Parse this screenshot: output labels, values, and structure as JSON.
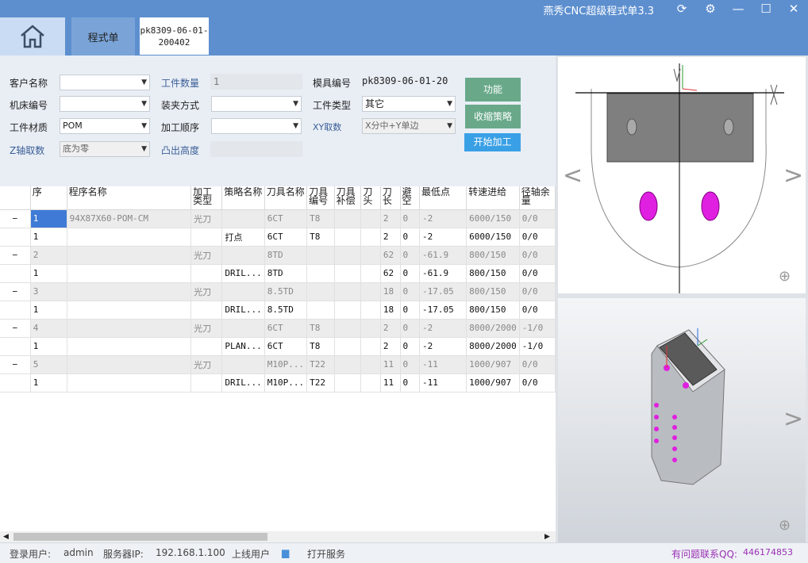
{
  "window": {
    "title": "燕秀CNC超级程式单3.3",
    "buttons": [
      "refresh-icon",
      "settings-icon",
      "minimize-icon",
      "maximize-icon",
      "close-icon"
    ]
  },
  "tabs": {
    "home_icon": "home-icon",
    "program_list": "程式单",
    "active_line1": "pk8309-06-01-",
    "active_line2": "200402"
  },
  "form": {
    "customer_label": "客户名称",
    "customer_value": "",
    "machine_label": "机床编号",
    "machine_value": "",
    "material_label": "工件材质",
    "material_value": "POM",
    "zaxis_label": "Z轴取数",
    "zaxis_value": "底为零",
    "qty_label": "工件数量",
    "qty_value": "1",
    "clamp_label": "装夹方式",
    "clamp_value": "",
    "order_label": "加工顺序",
    "order_value": "",
    "boss_label": "凸出高度",
    "boss_value": "",
    "mold_label": "模具编号",
    "mold_value": "pk8309-06-01-20",
    "type_label": "工件类型",
    "type_value": "其它",
    "xy_label": "XY取数",
    "xy_value": "X分中+Y单边",
    "btn_function": "功能",
    "btn_collapse": "收缩策略",
    "btn_start": "开始加工"
  },
  "table": {
    "headers": [
      "",
      "序",
      "程序名称",
      "加工类型",
      "策略名称",
      "刀具名称",
      "刀具编号",
      "刀具补偿",
      "刀头",
      "刀长",
      "避空",
      "最低点",
      "转速进给",
      "径轴余量"
    ],
    "rows": [
      {
        "kind": "parent",
        "cells": [
          "−",
          "1",
          "94X87X60-POM-CM",
          "光刀",
          "",
          "6CT",
          "T8",
          "",
          "",
          "2",
          "0",
          "-2",
          "6000/150",
          "0/0"
        ]
      },
      {
        "kind": "child",
        "cells": [
          "",
          "1",
          "",
          "",
          "打点",
          "6CT",
          "T8",
          "",
          "",
          "2",
          "0",
          "-2",
          "6000/150",
          "0/0"
        ]
      },
      {
        "kind": "parent",
        "cells": [
          "−",
          "2",
          "",
          "光刀",
          "",
          "8TD",
          "",
          "",
          "",
          "62",
          "0",
          "-61.9",
          "800/150",
          "0/0"
        ]
      },
      {
        "kind": "child",
        "cells": [
          "",
          "1",
          "",
          "",
          "DRIL...",
          "8TD",
          "",
          "",
          "",
          "62",
          "0",
          "-61.9",
          "800/150",
          "0/0"
        ]
      },
      {
        "kind": "parent",
        "cells": [
          "−",
          "3",
          "",
          "光刀",
          "",
          "8.5TD",
          "",
          "",
          "",
          "18",
          "0",
          "-17.05",
          "800/150",
          "0/0"
        ]
      },
      {
        "kind": "child",
        "cells": [
          "",
          "1",
          "",
          "",
          "DRIL...",
          "8.5TD",
          "",
          "",
          "",
          "18",
          "0",
          "-17.05",
          "800/150",
          "0/0"
        ]
      },
      {
        "kind": "parent",
        "cells": [
          "−",
          "4",
          "",
          "光刀",
          "",
          "6CT",
          "T8",
          "",
          "",
          "2",
          "0",
          "-2",
          "8000/2000",
          "-1/0"
        ]
      },
      {
        "kind": "child",
        "cells": [
          "",
          "1",
          "",
          "",
          "PLAN...",
          "6CT",
          "T8",
          "",
          "",
          "2",
          "0",
          "-2",
          "8000/2000",
          "-1/0"
        ]
      },
      {
        "kind": "parent",
        "cells": [
          "−",
          "5",
          "",
          "光刀",
          "",
          "M10P...",
          "T22",
          "",
          "",
          "11",
          "0",
          "-11",
          "1000/907",
          "0/0"
        ]
      },
      {
        "kind": "child",
        "cells": [
          "",
          "1",
          "",
          "",
          "DRIL...",
          "M10P...",
          "T22",
          "",
          "",
          "11",
          "0",
          "-11",
          "1000/907",
          "0/0"
        ]
      }
    ]
  },
  "statusbar": {
    "login_label": "登录用户:",
    "login_user": "admin",
    "server_label": "服务器IP:",
    "server_ip": "192.168.1.100",
    "online_users": "上线用户",
    "folder_icon": "folder-icon",
    "open_service": "打开服务",
    "contact": "有问题联系QQ:",
    "qq": "446174853"
  },
  "colors": {
    "titlebar": "#5d8fcf",
    "button_green": "#69a98a",
    "button_blue": "#3aa0e6",
    "magenta": "#e020e0",
    "selected_cell": "#3f7bd6"
  }
}
